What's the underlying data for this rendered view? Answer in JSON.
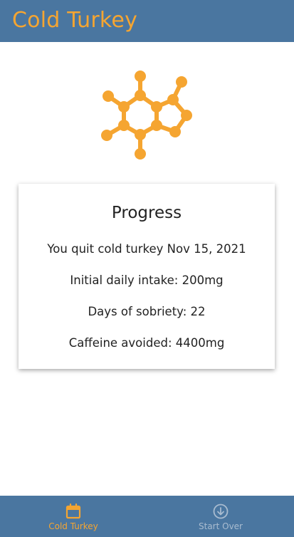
{
  "app": {
    "title": "Cold Turkey",
    "accent_color": "#f5a531",
    "bar_color": "#4a76a0",
    "logo_icon": "caffeine-molecule-icon"
  },
  "progress_card": {
    "heading": "Progress",
    "quit_text": "You quit cold turkey Nov 15, 2021",
    "initial_intake_text": "Initial daily intake: 200mg",
    "sobriety_text": "Days of sobriety: 22",
    "avoided_text": "Caffeine avoided: 4400mg"
  },
  "bottom_nav": {
    "items": [
      {
        "label": "Cold Turkey",
        "icon": "calendar-icon",
        "active": true
      },
      {
        "label": "Start Over",
        "icon": "download-circle-icon",
        "active": false
      }
    ]
  }
}
